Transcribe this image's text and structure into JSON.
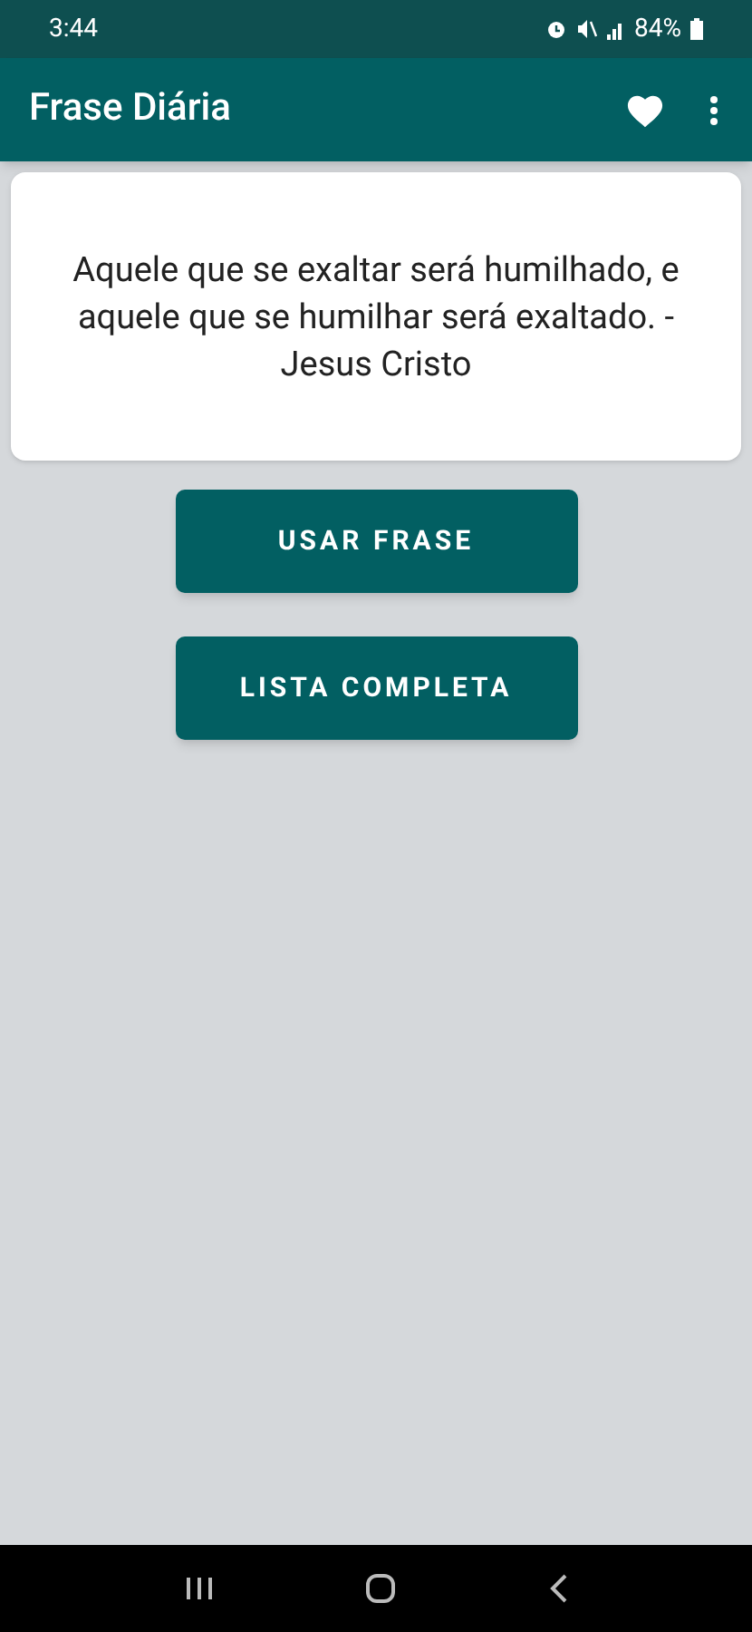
{
  "status_bar": {
    "time": "3:44",
    "battery": "84%"
  },
  "app_bar": {
    "title": "Frase Diária"
  },
  "quote": {
    "text": "Aquele que se exaltar será humilhado, e aquele que se humilhar será exaltado. - Jesus Cristo"
  },
  "buttons": [
    "USAR FRASE",
    "LISTA COMPLETA"
  ]
}
